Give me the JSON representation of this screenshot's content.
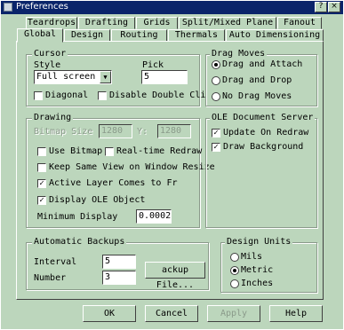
{
  "window": {
    "title": "Preferences",
    "close_glyph": "×",
    "help_glyph": "?"
  },
  "tabs_back": [
    "Teardrops",
    "Drafting",
    "Grids",
    "Split/Mixed Plane",
    "Fanout"
  ],
  "tabs_front": [
    "Global",
    "Design",
    "Routing",
    "Thermals",
    "Auto Dimensioning"
  ],
  "cursor": {
    "legend": "Cursor",
    "style_label": "Style",
    "style_value": "Full screen",
    "pick_label": "Pick",
    "pick_value": "5",
    "diagonal_label": "Diagonal",
    "disable_double_click_label": "Disable Double Cli"
  },
  "drag_moves": {
    "legend": "Drag Moves",
    "options": [
      "Drag and Attach",
      "Drag and Drop",
      "No Drag Moves"
    ],
    "selected": "Drag and Attach"
  },
  "drawing": {
    "legend": "Drawing",
    "bitmap_size_label": "Bitmap Size",
    "bitmap_x": "1280",
    "bitmap_y_label": "Y:",
    "bitmap_y": "1280",
    "use_bitmap_label": "Use Bitmap",
    "realtime_redraw_label": "Real-time Redraw",
    "keep_same_view_label": "Keep Same View on Window Resize",
    "active_layer_label": "Active Layer Comes to Fr",
    "display_ole_label": "Display OLE Object",
    "minimum_display_label": "Minimum Display",
    "minimum_display_value": "0.0002",
    "active_layer_checked": true,
    "display_ole_checked": true
  },
  "ole": {
    "legend": "OLE Document Server",
    "update_on_redraw_label": "Update On Redraw",
    "draw_background_label": "Draw Background",
    "update_checked": true,
    "draw_bg_checked": true
  },
  "backups": {
    "legend": "Automatic Backups",
    "interval_label": "Interval",
    "interval_value": "5",
    "number_label": "Number",
    "number_value": "3",
    "backup_file_button": "ackup File..."
  },
  "design_units": {
    "legend": "Design Units",
    "options": [
      "Mils",
      "Metric",
      "Inches"
    ],
    "selected": "Metric"
  },
  "buttons": {
    "ok": "OK",
    "cancel": "Cancel",
    "apply": "Apply",
    "help": "Help"
  },
  "check_glyph": "✓",
  "dropdown_glyph": "▼"
}
